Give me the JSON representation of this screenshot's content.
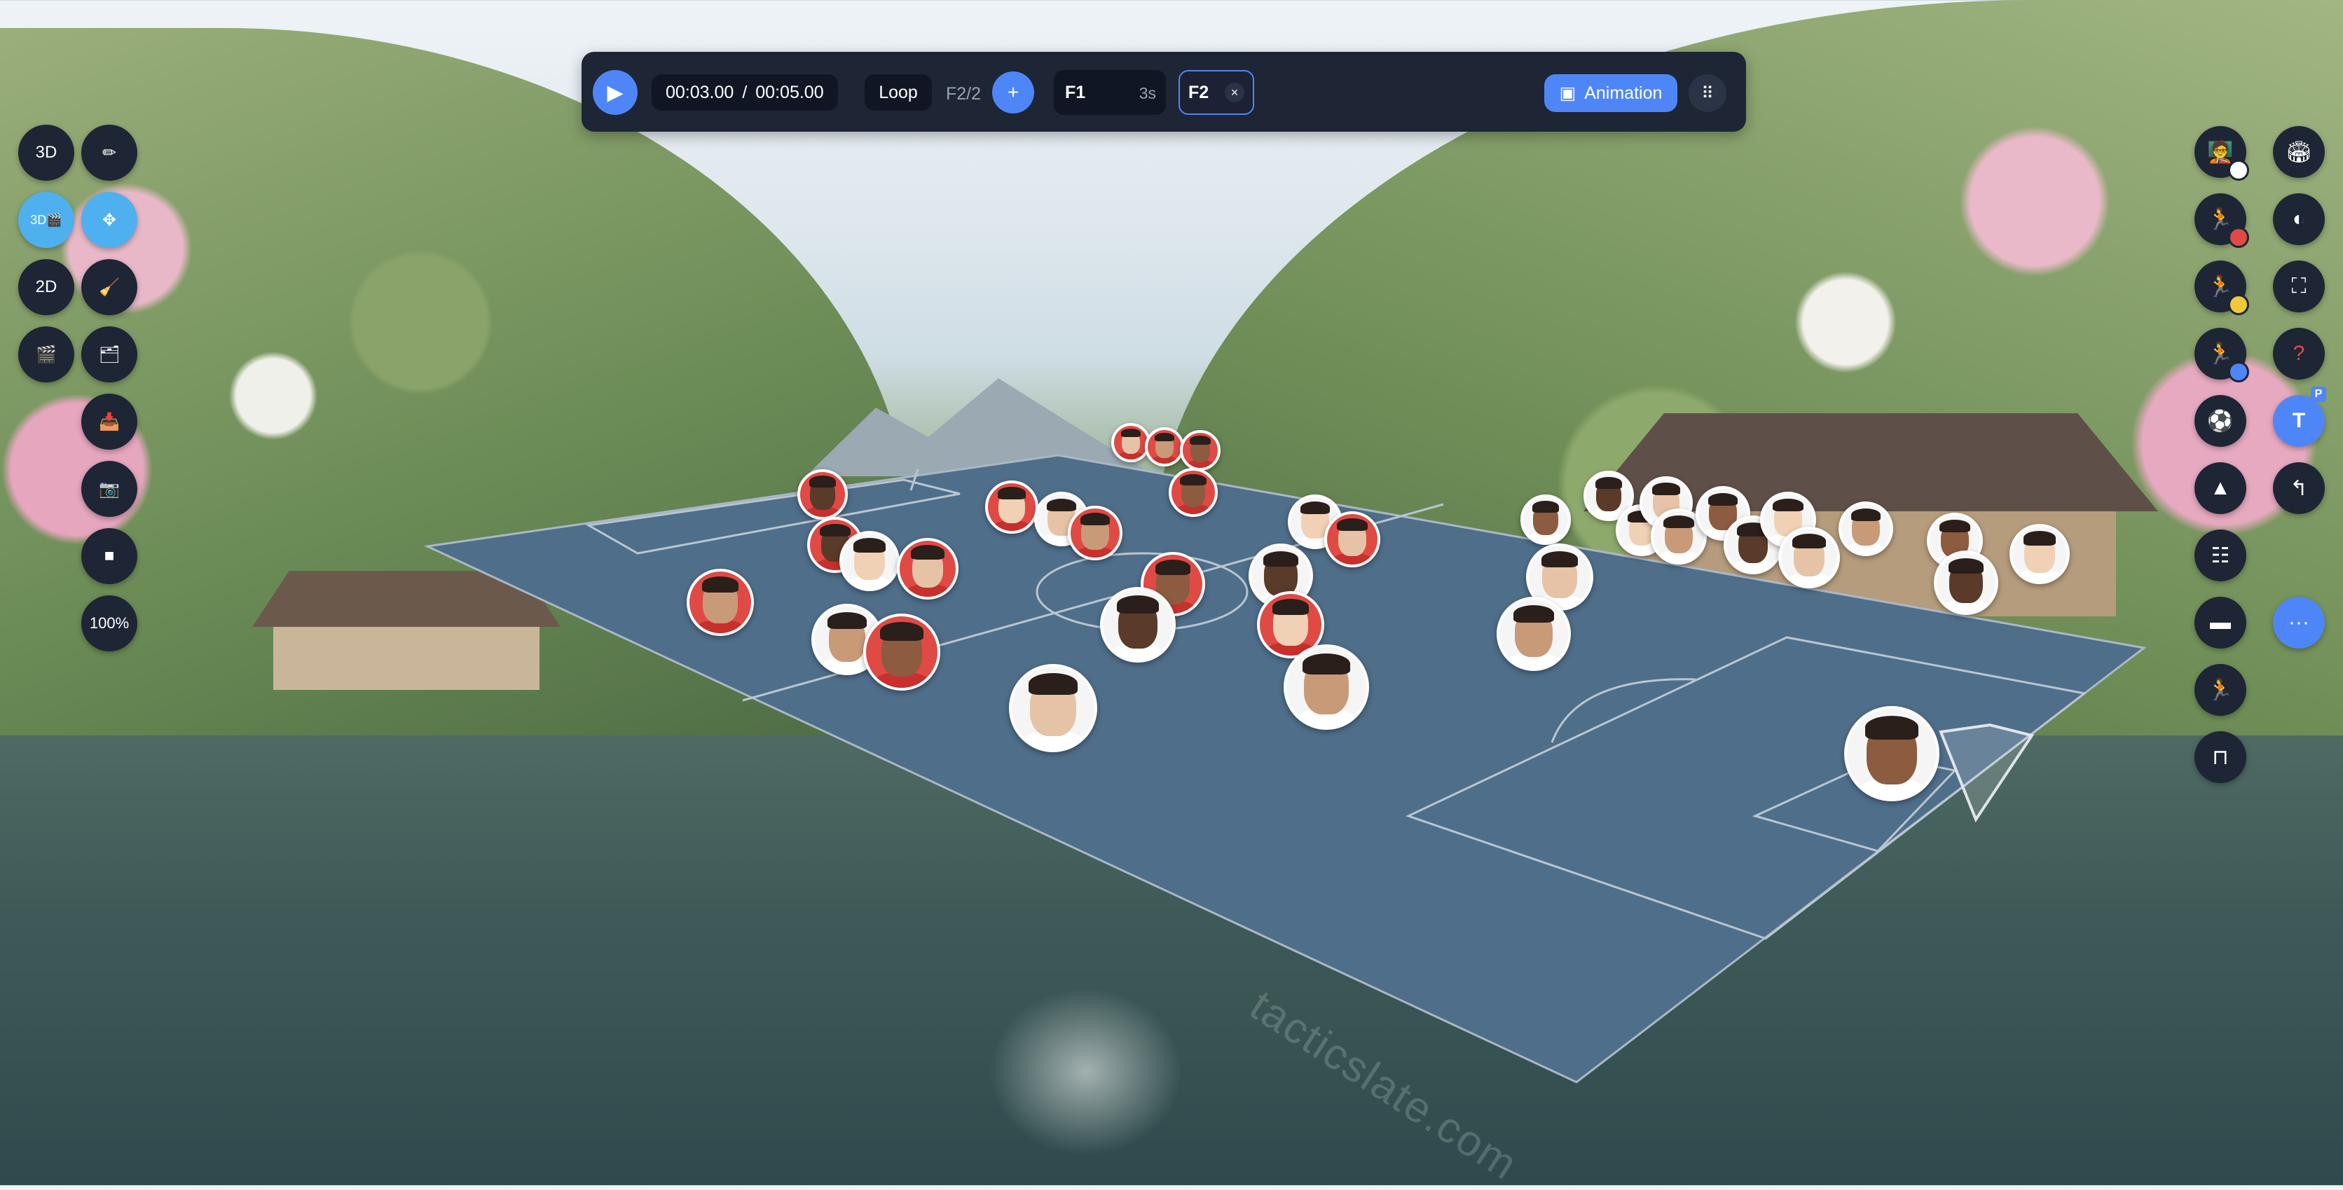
{
  "toolbar": {
    "play_icon": "play-icon",
    "current_time": "00:03.00",
    "separator": "/",
    "total_time": "00:05.00",
    "loop_label": "Loop",
    "frame_counter": "F2/2",
    "add_label": "+",
    "frames": [
      {
        "label": "F1",
        "duration": "3s"
      },
      {
        "label": "F2",
        "close": "×"
      }
    ],
    "animation_label": "Animation",
    "more_icon": "⠿"
  },
  "left_tools": {
    "view_3d": "3D",
    "view_3d_movie": "3D🎬",
    "view_2d": "2D",
    "zoom": "100%"
  },
  "right_tools": {
    "text_tool": "T",
    "text_badge": "P",
    "help": "?",
    "more": "···"
  },
  "watermark": "tacticslate.com",
  "colors": {
    "accent": "#4f86f7",
    "panel": "#1e2535",
    "pitch": "#4f6e8a",
    "team_red": "#e04a45",
    "team_white": "#f5f5f5"
  }
}
